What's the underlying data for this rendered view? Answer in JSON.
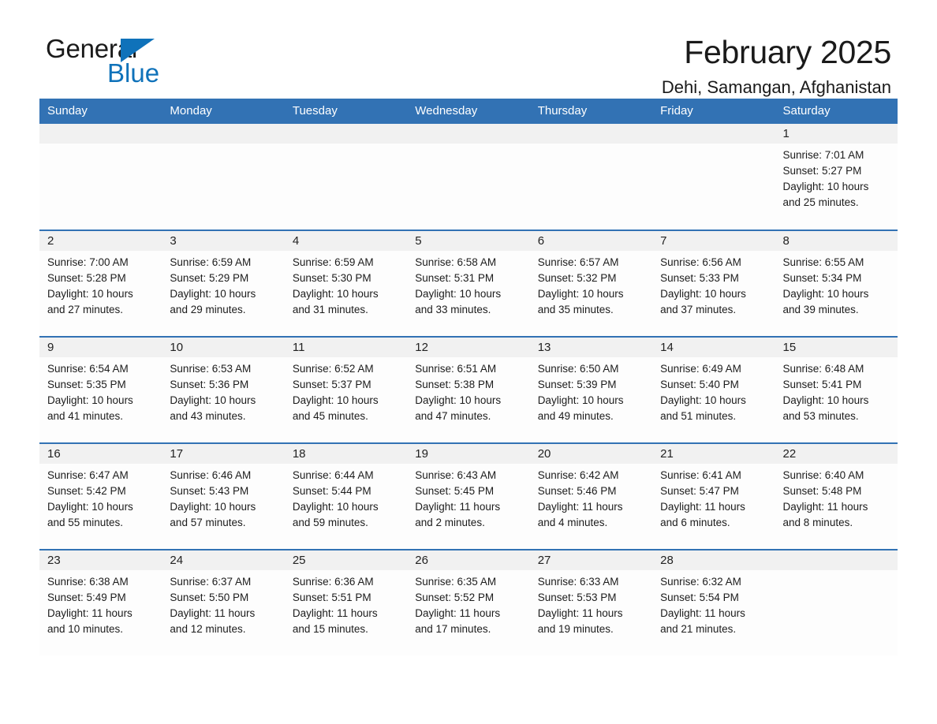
{
  "brand": {
    "name_part1": "General",
    "name_part2": "Blue",
    "logo_black": "#1a1a1a",
    "logo_blue": "#0f72ba"
  },
  "header": {
    "title": "February 2025",
    "location": "Dehi, Samangan, Afghanistan"
  },
  "theme": {
    "header_blue": "#3272b4",
    "row_divider_blue": "#3272b4",
    "daynum_band": "#f1f1f1",
    "cell_background": "#fdfdfd",
    "text": "#1c1c1c"
  },
  "weekdays": [
    "Sunday",
    "Monday",
    "Tuesday",
    "Wednesday",
    "Thursday",
    "Friday",
    "Saturday"
  ],
  "weeks": [
    [
      {
        "day": "",
        "sunrise": "",
        "sunset": "",
        "daylight_line1": "",
        "daylight_line2": ""
      },
      {
        "day": "",
        "sunrise": "",
        "sunset": "",
        "daylight_line1": "",
        "daylight_line2": ""
      },
      {
        "day": "",
        "sunrise": "",
        "sunset": "",
        "daylight_line1": "",
        "daylight_line2": ""
      },
      {
        "day": "",
        "sunrise": "",
        "sunset": "",
        "daylight_line1": "",
        "daylight_line2": ""
      },
      {
        "day": "",
        "sunrise": "",
        "sunset": "",
        "daylight_line1": "",
        "daylight_line2": ""
      },
      {
        "day": "",
        "sunrise": "",
        "sunset": "",
        "daylight_line1": "",
        "daylight_line2": ""
      },
      {
        "day": "1",
        "sunrise": "Sunrise: 7:01 AM",
        "sunset": "Sunset: 5:27 PM",
        "daylight_line1": "Daylight: 10 hours",
        "daylight_line2": "and 25 minutes."
      }
    ],
    [
      {
        "day": "2",
        "sunrise": "Sunrise: 7:00 AM",
        "sunset": "Sunset: 5:28 PM",
        "daylight_line1": "Daylight: 10 hours",
        "daylight_line2": "and 27 minutes."
      },
      {
        "day": "3",
        "sunrise": "Sunrise: 6:59 AM",
        "sunset": "Sunset: 5:29 PM",
        "daylight_line1": "Daylight: 10 hours",
        "daylight_line2": "and 29 minutes."
      },
      {
        "day": "4",
        "sunrise": "Sunrise: 6:59 AM",
        "sunset": "Sunset: 5:30 PM",
        "daylight_line1": "Daylight: 10 hours",
        "daylight_line2": "and 31 minutes."
      },
      {
        "day": "5",
        "sunrise": "Sunrise: 6:58 AM",
        "sunset": "Sunset: 5:31 PM",
        "daylight_line1": "Daylight: 10 hours",
        "daylight_line2": "and 33 minutes."
      },
      {
        "day": "6",
        "sunrise": "Sunrise: 6:57 AM",
        "sunset": "Sunset: 5:32 PM",
        "daylight_line1": "Daylight: 10 hours",
        "daylight_line2": "and 35 minutes."
      },
      {
        "day": "7",
        "sunrise": "Sunrise: 6:56 AM",
        "sunset": "Sunset: 5:33 PM",
        "daylight_line1": "Daylight: 10 hours",
        "daylight_line2": "and 37 minutes."
      },
      {
        "day": "8",
        "sunrise": "Sunrise: 6:55 AM",
        "sunset": "Sunset: 5:34 PM",
        "daylight_line1": "Daylight: 10 hours",
        "daylight_line2": "and 39 minutes."
      }
    ],
    [
      {
        "day": "9",
        "sunrise": "Sunrise: 6:54 AM",
        "sunset": "Sunset: 5:35 PM",
        "daylight_line1": "Daylight: 10 hours",
        "daylight_line2": "and 41 minutes."
      },
      {
        "day": "10",
        "sunrise": "Sunrise: 6:53 AM",
        "sunset": "Sunset: 5:36 PM",
        "daylight_line1": "Daylight: 10 hours",
        "daylight_line2": "and 43 minutes."
      },
      {
        "day": "11",
        "sunrise": "Sunrise: 6:52 AM",
        "sunset": "Sunset: 5:37 PM",
        "daylight_line1": "Daylight: 10 hours",
        "daylight_line2": "and 45 minutes."
      },
      {
        "day": "12",
        "sunrise": "Sunrise: 6:51 AM",
        "sunset": "Sunset: 5:38 PM",
        "daylight_line1": "Daylight: 10 hours",
        "daylight_line2": "and 47 minutes."
      },
      {
        "day": "13",
        "sunrise": "Sunrise: 6:50 AM",
        "sunset": "Sunset: 5:39 PM",
        "daylight_line1": "Daylight: 10 hours",
        "daylight_line2": "and 49 minutes."
      },
      {
        "day": "14",
        "sunrise": "Sunrise: 6:49 AM",
        "sunset": "Sunset: 5:40 PM",
        "daylight_line1": "Daylight: 10 hours",
        "daylight_line2": "and 51 minutes."
      },
      {
        "day": "15",
        "sunrise": "Sunrise: 6:48 AM",
        "sunset": "Sunset: 5:41 PM",
        "daylight_line1": "Daylight: 10 hours",
        "daylight_line2": "and 53 minutes."
      }
    ],
    [
      {
        "day": "16",
        "sunrise": "Sunrise: 6:47 AM",
        "sunset": "Sunset: 5:42 PM",
        "daylight_line1": "Daylight: 10 hours",
        "daylight_line2": "and 55 minutes."
      },
      {
        "day": "17",
        "sunrise": "Sunrise: 6:46 AM",
        "sunset": "Sunset: 5:43 PM",
        "daylight_line1": "Daylight: 10 hours",
        "daylight_line2": "and 57 minutes."
      },
      {
        "day": "18",
        "sunrise": "Sunrise: 6:44 AM",
        "sunset": "Sunset: 5:44 PM",
        "daylight_line1": "Daylight: 10 hours",
        "daylight_line2": "and 59 minutes."
      },
      {
        "day": "19",
        "sunrise": "Sunrise: 6:43 AM",
        "sunset": "Sunset: 5:45 PM",
        "daylight_line1": "Daylight: 11 hours",
        "daylight_line2": "and 2 minutes."
      },
      {
        "day": "20",
        "sunrise": "Sunrise: 6:42 AM",
        "sunset": "Sunset: 5:46 PM",
        "daylight_line1": "Daylight: 11 hours",
        "daylight_line2": "and 4 minutes."
      },
      {
        "day": "21",
        "sunrise": "Sunrise: 6:41 AM",
        "sunset": "Sunset: 5:47 PM",
        "daylight_line1": "Daylight: 11 hours",
        "daylight_line2": "and 6 minutes."
      },
      {
        "day": "22",
        "sunrise": "Sunrise: 6:40 AM",
        "sunset": "Sunset: 5:48 PM",
        "daylight_line1": "Daylight: 11 hours",
        "daylight_line2": "and 8 minutes."
      }
    ],
    [
      {
        "day": "23",
        "sunrise": "Sunrise: 6:38 AM",
        "sunset": "Sunset: 5:49 PM",
        "daylight_line1": "Daylight: 11 hours",
        "daylight_line2": "and 10 minutes."
      },
      {
        "day": "24",
        "sunrise": "Sunrise: 6:37 AM",
        "sunset": "Sunset: 5:50 PM",
        "daylight_line1": "Daylight: 11 hours",
        "daylight_line2": "and 12 minutes."
      },
      {
        "day": "25",
        "sunrise": "Sunrise: 6:36 AM",
        "sunset": "Sunset: 5:51 PM",
        "daylight_line1": "Daylight: 11 hours",
        "daylight_line2": "and 15 minutes."
      },
      {
        "day": "26",
        "sunrise": "Sunrise: 6:35 AM",
        "sunset": "Sunset: 5:52 PM",
        "daylight_line1": "Daylight: 11 hours",
        "daylight_line2": "and 17 minutes."
      },
      {
        "day": "27",
        "sunrise": "Sunrise: 6:33 AM",
        "sunset": "Sunset: 5:53 PM",
        "daylight_line1": "Daylight: 11 hours",
        "daylight_line2": "and 19 minutes."
      },
      {
        "day": "28",
        "sunrise": "Sunrise: 6:32 AM",
        "sunset": "Sunset: 5:54 PM",
        "daylight_line1": "Daylight: 11 hours",
        "daylight_line2": "and 21 minutes."
      },
      {
        "day": "",
        "sunrise": "",
        "sunset": "",
        "daylight_line1": "",
        "daylight_line2": ""
      }
    ]
  ]
}
